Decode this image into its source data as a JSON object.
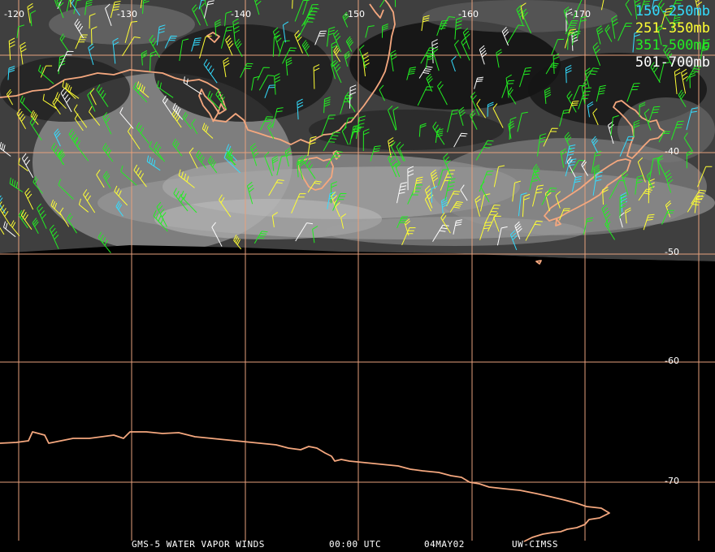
{
  "title": {
    "product": "GMS-5 WATER VAPOR WINDS",
    "time": "00:00 UTC",
    "date": "04MAY02",
    "source": "UW-CIMSS"
  },
  "legend": [
    {
      "label": "150-250mb",
      "color": "#33ddff"
    },
    {
      "label": "251-350mb",
      "color": "#ffff33"
    },
    {
      "label": "351-500mb",
      "color": "#22ee22"
    },
    {
      "label": "501-700mb",
      "color": "#ffffff"
    }
  ],
  "longitude_labels": [
    "-120",
    "-130",
    "-140",
    "-150",
    "-160",
    "-170"
  ],
  "latitude_labels": [
    "-40",
    "-50",
    "-60",
    "-70"
  ],
  "colors": {
    "coastline": "#f4a77e",
    "grid": "#e6a07c",
    "background": "#000000"
  }
}
